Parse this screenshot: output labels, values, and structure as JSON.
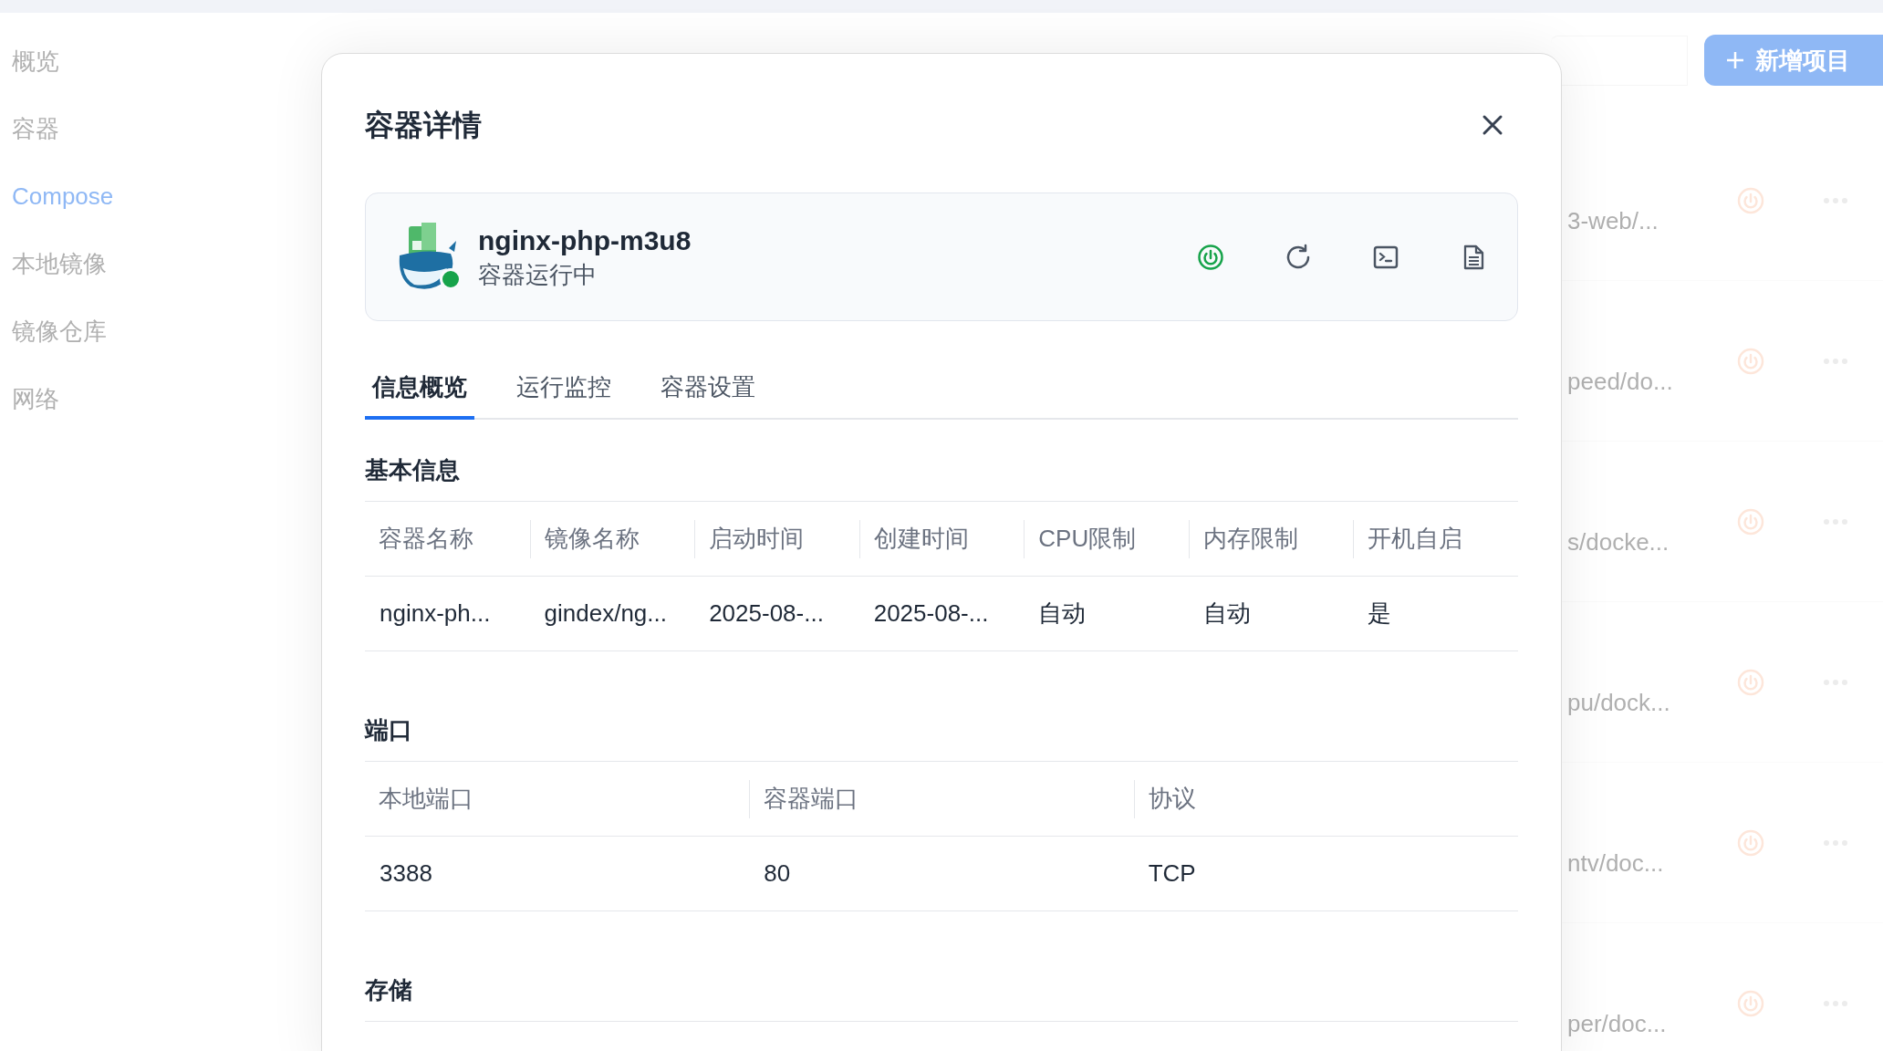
{
  "sidebar": {
    "items": [
      {
        "label": "概览",
        "selected": false
      },
      {
        "label": "容器",
        "selected": false
      },
      {
        "label": "Compose",
        "selected": true
      },
      {
        "label": "本地镜像",
        "selected": false
      },
      {
        "label": "镜像仓库",
        "selected": false
      },
      {
        "label": "网络",
        "selected": false
      }
    ]
  },
  "background_list": {
    "add_button": "新增项目",
    "rows": [
      {
        "path": "3-web/..."
      },
      {
        "path": "peed/do..."
      },
      {
        "path": "s/docke..."
      },
      {
        "path": "pu/dock..."
      },
      {
        "path": "ntv/doc..."
      },
      {
        "path": "per/doc..."
      }
    ]
  },
  "dialog": {
    "title": "容器详情",
    "container": {
      "name": "nginx-php-m3u8",
      "status": "容器运行中",
      "running": true
    },
    "tabs": [
      {
        "label": "信息概览",
        "selected": true
      },
      {
        "label": "运行监控",
        "selected": false
      },
      {
        "label": "容器设置",
        "selected": false
      }
    ],
    "sections": [
      {
        "title": "基本信息",
        "columns": [
          "容器名称",
          "镜像名称",
          "启动时间",
          "创建时间",
          "CPU限制",
          "内存限制",
          "开机自启"
        ],
        "rows": [
          [
            "nginx-ph...",
            "gindex/ng...",
            "2025-08-...",
            "2025-08-...",
            "自动",
            "自动",
            "是"
          ]
        ]
      },
      {
        "title": "端口",
        "columns": [
          "本地端口",
          "容器端口",
          "协议"
        ],
        "rows": [
          [
            "3388",
            "80",
            "TCP"
          ]
        ]
      },
      {
        "title": "存储"
      }
    ]
  }
}
